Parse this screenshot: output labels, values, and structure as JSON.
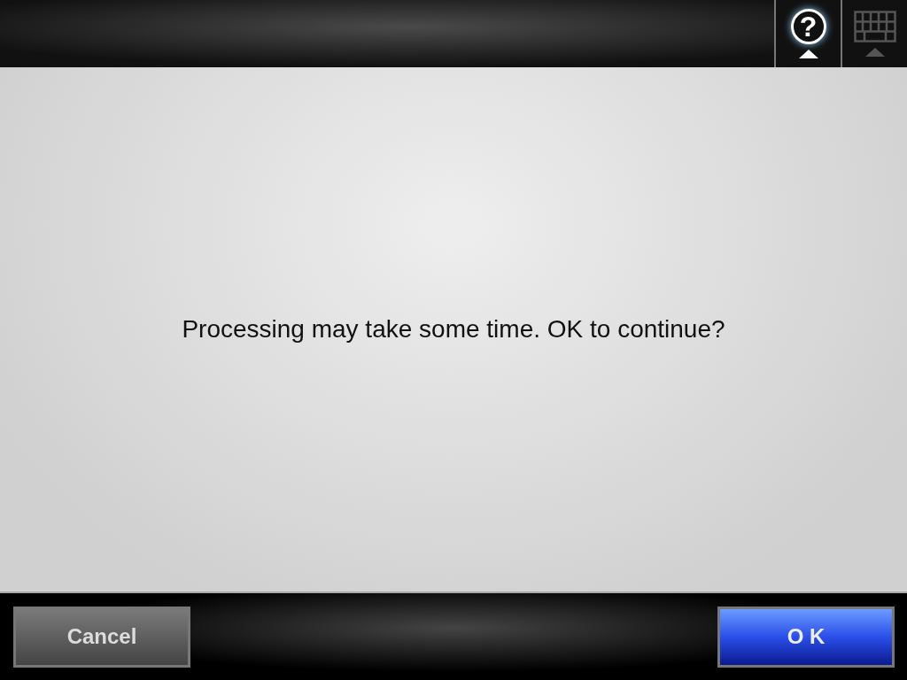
{
  "toolbar": [
    {
      "kind": "help",
      "label": "?",
      "disabled": false
    },
    {
      "kind": "keyboard",
      "disabled": true
    }
  ],
  "message": "Processing may take some time. OK to continue?",
  "buttons": [
    {
      "kind": "cancel",
      "label": "Cancel"
    },
    {
      "kind": "ok",
      "label": "O K"
    }
  ]
}
